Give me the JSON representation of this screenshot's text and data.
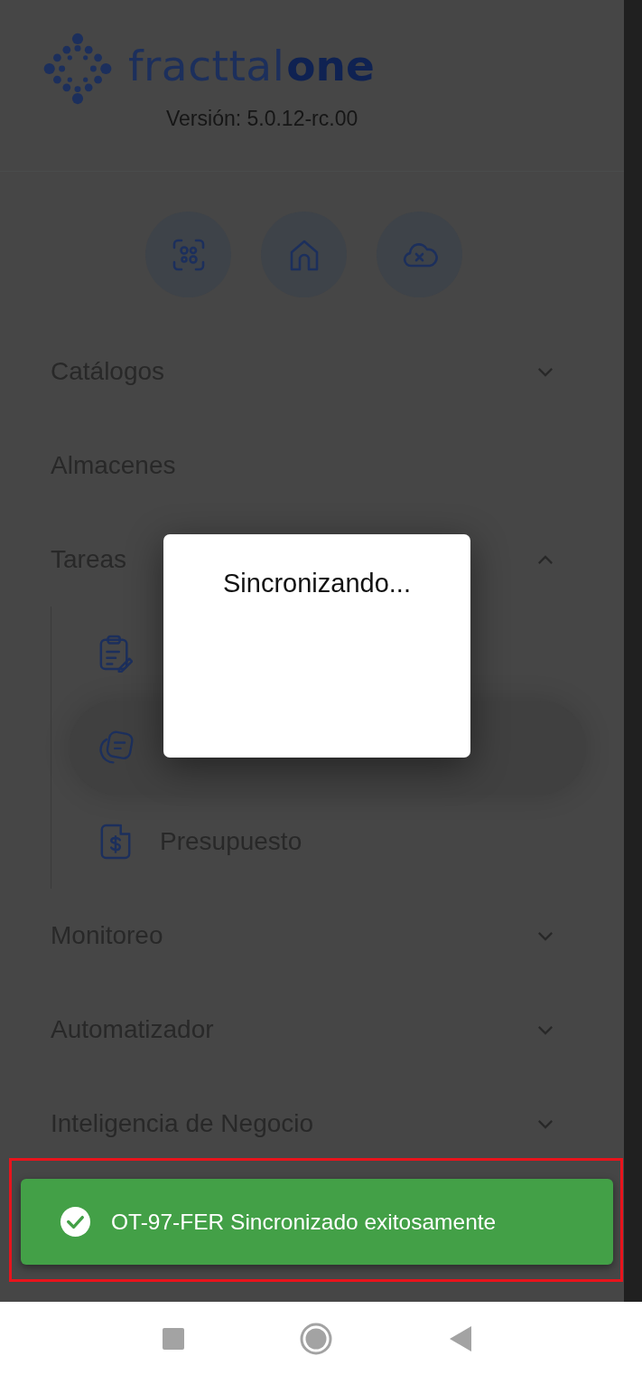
{
  "logo": {
    "brand": "fracttal",
    "product": "one"
  },
  "version": "Versión: 5.0.12-rc.00",
  "quick_actions": [
    {
      "kind": "scan"
    },
    {
      "kind": "home"
    },
    {
      "kind": "cloud-off"
    }
  ],
  "menu": [
    {
      "label": "Catálogos",
      "expanded": false
    },
    {
      "label": "Almacenes"
    },
    {
      "label": "Tareas",
      "expanded": true,
      "children": [
        {
          "kind": "clipboard",
          "selected": false
        },
        {
          "kind": "notes",
          "selected": true
        },
        {
          "kind": "budget",
          "label": "Presupuesto",
          "selected": false
        }
      ]
    },
    {
      "label": "Monitoreo",
      "expanded": false
    },
    {
      "label": "Automatizador",
      "expanded": false
    },
    {
      "label": "Inteligencia de Negocio",
      "expanded": false
    }
  ],
  "dialog": {
    "message": "Sincronizando..."
  },
  "toast": {
    "message": "OT-97-FER Sincronizado exitosamente"
  }
}
